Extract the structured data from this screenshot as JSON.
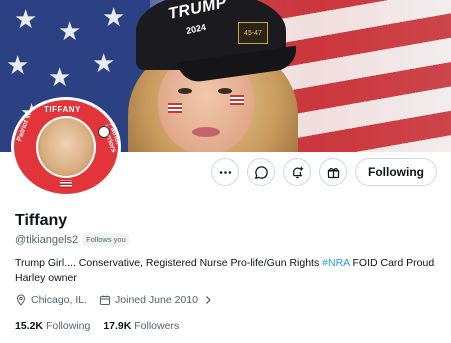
{
  "banner": {
    "hat_text": "TRUMP",
    "hat_year": "2024",
    "hat_badge": "45-47"
  },
  "avatar": {
    "top_text": "TIFFANY",
    "left_text": "Patriot Warriors",
    "right_text": "Patriot Warriors"
  },
  "actions": {
    "more_icon": "more-horizontal-icon",
    "message_icon": "message-icon",
    "notify_icon": "notification-bell-plus-icon",
    "subscribe_icon": "gift-icon",
    "follow_label": "Following"
  },
  "profile": {
    "display_name": "Tiffany",
    "handle": "@tikiangels2",
    "follows_you": "Follows you",
    "bio_before": "Trump Girl.... Conservative, Registered Nurse Pro-life/Gun Rights ",
    "bio_hashtag": "#NRA",
    "bio_after": " FOID Card Proud Harley owner",
    "location": "Chicago, IL.",
    "joined": "Joined June 2010",
    "following_count": "15.2K",
    "following_label": "Following",
    "followers_count": "17.9K",
    "followers_label": "Followers"
  },
  "colors": {
    "accent": "#1d9bf0",
    "secondary_text": "#536471",
    "border": "#cfd9de"
  }
}
